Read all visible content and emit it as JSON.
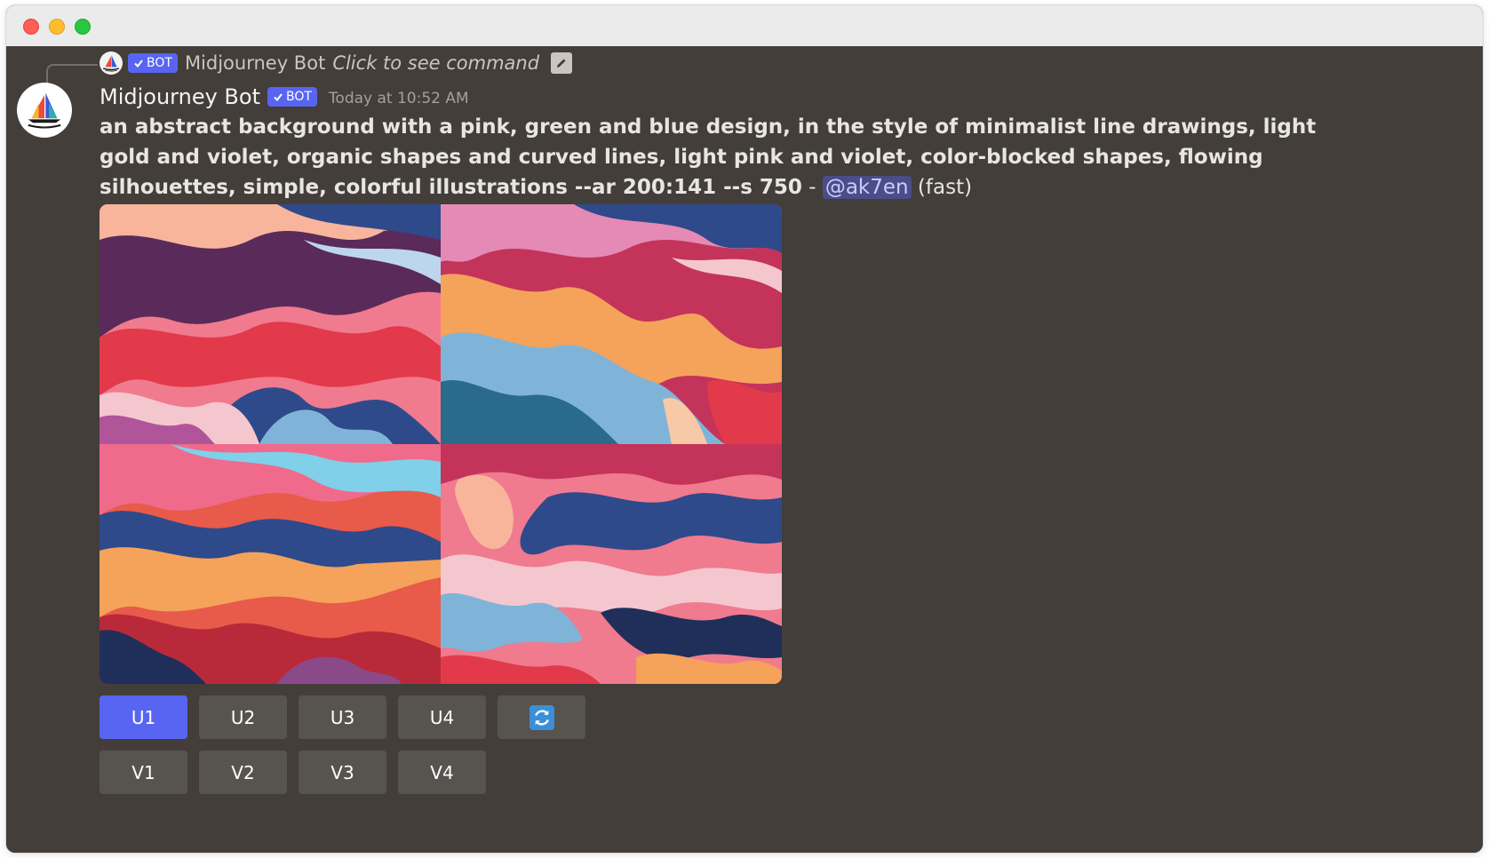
{
  "window": {
    "controls": [
      "close",
      "minimize",
      "zoom"
    ]
  },
  "reply": {
    "bot_badge": "BOT",
    "name": "Midjourney Bot",
    "command_hint": "Click to see command",
    "edit_icon": "pencil-square-icon"
  },
  "message": {
    "author": "Midjourney Bot",
    "bot_badge": "BOT",
    "timestamp": "Today at 10:52 AM",
    "prompt": "an abstract background with a pink, green and blue design, in the style of minimalist line drawings, light gold and violet, organic shapes and curved lines, light pink and violet, color-blocked shapes, flowing silhouettes, simple, colorful illustrations --ar 200:141 --s 750",
    "separator": " - ",
    "mention": "@ak7en",
    "speed": " (fast)"
  },
  "image_grid": {
    "tiles": [
      "tile-1",
      "tile-2",
      "tile-3",
      "tile-4"
    ],
    "palette": [
      "#f06a8c",
      "#2e4a8a",
      "#7fb4d8",
      "#f5a25a",
      "#e23a4a",
      "#5a2a5a",
      "#f4c7cf"
    ]
  },
  "buttons": {
    "upscale": [
      "U1",
      "U2",
      "U3",
      "U4"
    ],
    "reroll_icon": "refresh-icon",
    "variation": [
      "V1",
      "V2",
      "V3",
      "V4"
    ]
  },
  "colors": {
    "chat_bg": "#433e39",
    "blurple": "#5865f2",
    "button_grey": "#57534e"
  }
}
